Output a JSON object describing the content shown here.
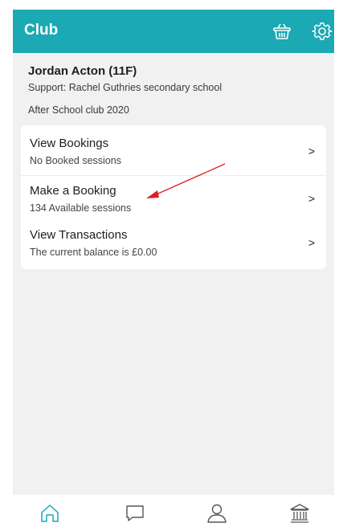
{
  "header": {
    "title": "Club",
    "basket_icon": "basket-icon",
    "settings_icon": "gear-icon"
  },
  "student": {
    "name": "Jordan Acton (11F)",
    "support": "Support: Rachel Guthries secondary school",
    "club": "After School club 2020"
  },
  "menu": {
    "items": [
      {
        "title": "View Bookings",
        "subtitle": "No Booked sessions",
        "chevron": ">"
      },
      {
        "title": "Make a Booking",
        "subtitle": "134 Available sessions",
        "chevron": ">"
      },
      {
        "title": "View Transactions",
        "subtitle": "The current balance is £0.00",
        "chevron": ">"
      }
    ]
  },
  "bottom_nav": {
    "items": [
      "home-icon",
      "chat-icon",
      "user-icon",
      "bank-icon"
    ]
  },
  "colors": {
    "accent": "#1ba9b4",
    "annotation": "#e01e1e",
    "background": "#f1f1f1"
  }
}
